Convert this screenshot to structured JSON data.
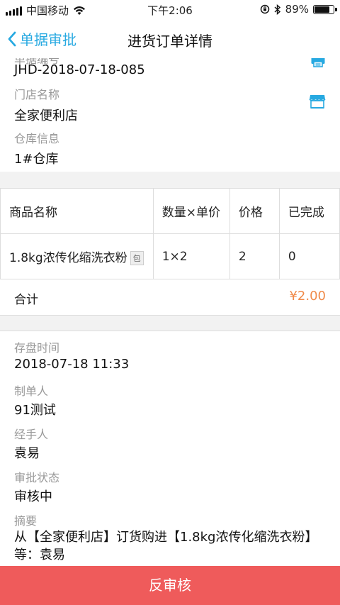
{
  "status_bar": {
    "carrier": "中国移动",
    "time": "下午2:06",
    "battery": "89%",
    "battery_level": 0.89
  },
  "nav": {
    "back_label": "单据审批",
    "title": "进货订单详情"
  },
  "order": {
    "number_label": "单据编号",
    "number_value": "JHD-2018-07-18-085",
    "store_label": "门店名称",
    "store_value": "全家便利店",
    "warehouse_label": "仓库信息",
    "warehouse_value": "1#仓库"
  },
  "table": {
    "headers": [
      "商品名称",
      "数量×单价",
      "价格",
      "已完成"
    ],
    "rows": [
      {
        "name": "1.8kg浓传化缩洗衣粉",
        "tag": "包",
        "qty_price": "1×2",
        "price": "2",
        "done": "0"
      }
    ]
  },
  "total": {
    "label": "合计",
    "amount": "¥2.00"
  },
  "details": {
    "stock_time_label": "存盘时间",
    "stock_time_value": "2018-07-18 11:33",
    "creator_label": "制单人",
    "creator_value": "91测试",
    "handler_label": "经手人",
    "handler_value": "袁易",
    "status_label": "审批状态",
    "status_value": "审核中",
    "summary_label": "摘要",
    "summary_value": "从【全家便利店】订货购进【1.8kg浓传化缩洗衣粉】等：袁易"
  },
  "action": {
    "reverse_audit_label": "反审核"
  },
  "colors": {
    "accent": "#27a9e1",
    "amount": "#f08a49",
    "button": "#ef5b5b"
  },
  "icons": [
    "wifi-icon",
    "lock-rotation-icon",
    "bluetooth-icon",
    "printer-icon",
    "store-icon",
    "chevron-left-icon"
  ]
}
